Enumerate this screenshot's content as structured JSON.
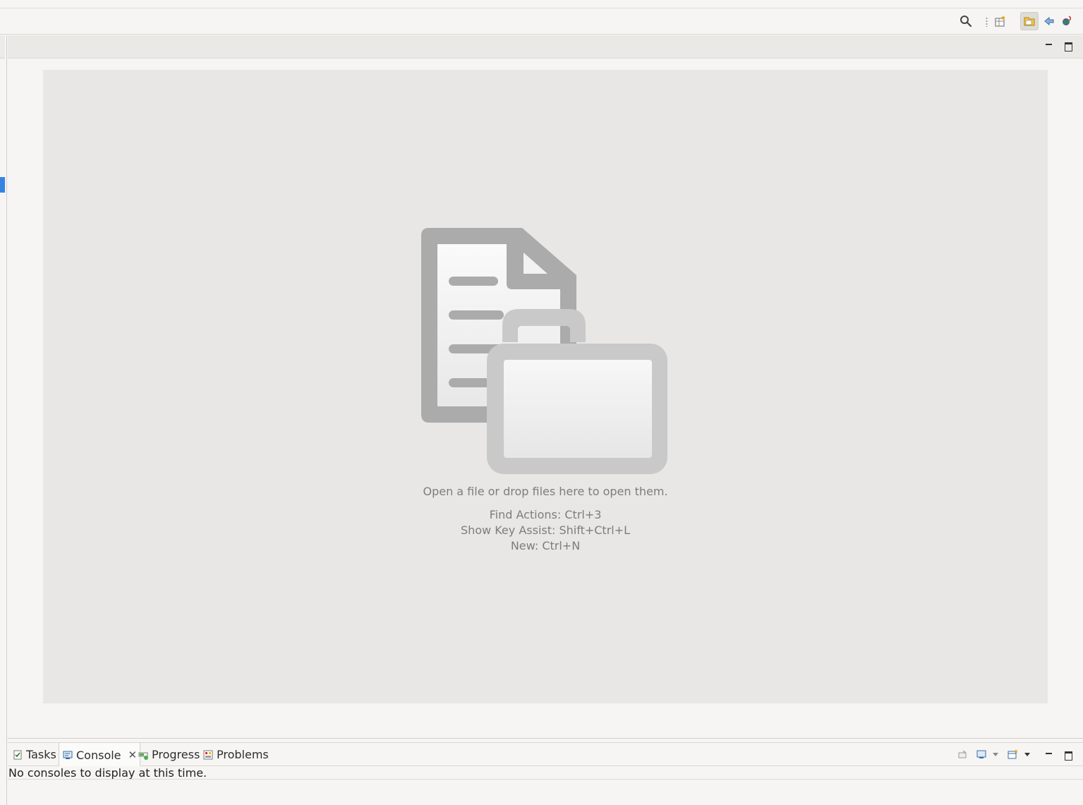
{
  "toolbar": {
    "icons": [
      "search-icon",
      "open-perspective-icon",
      "resource-perspective-icon",
      "debug-perspective-icon",
      "java-perspective-icon"
    ]
  },
  "editor": {
    "open_message": "Open a file or drop files here to open them.",
    "hints": [
      "Find Actions: Ctrl+3",
      "Show Key Assist: Shift+Ctrl+L",
      "New: Ctrl+N"
    ]
  },
  "bottom_panel": {
    "tabs": [
      {
        "label": "Tasks",
        "icon": "tasks-icon"
      },
      {
        "label": "Console",
        "icon": "console-icon",
        "active": true
      },
      {
        "label": "Progress",
        "icon": "progress-icon"
      },
      {
        "label": "Problems",
        "icon": "problems-icon"
      }
    ],
    "console_message": "No consoles to display at this time."
  },
  "colors": {
    "accent": "#3584e4",
    "dropzone": "#e8e7e5",
    "hint_text": "#7d7d7d"
  }
}
